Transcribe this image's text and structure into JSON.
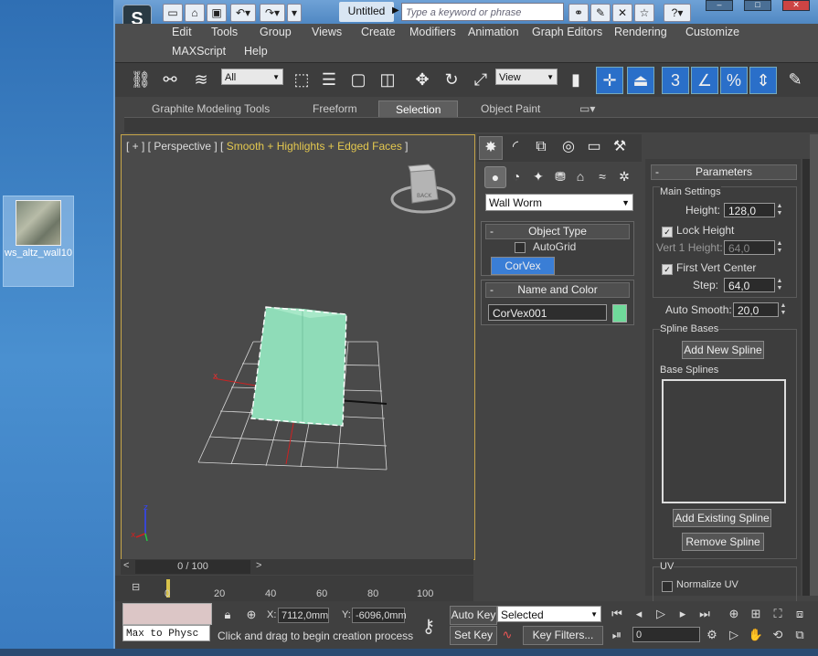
{
  "desktop": {
    "icon_label": "ws_altz_wall10"
  },
  "titlebar": {
    "document_title": "Untitled",
    "search_placeholder": "Type a keyword or phrase",
    "logo_glyph": "S"
  },
  "menu": {
    "row1": [
      "Edit",
      "Tools",
      "Group",
      "Views",
      "Create",
      "Modifiers",
      "Animation",
      "Graph Editors",
      "Rendering",
      "Customize"
    ],
    "row2": [
      "MAXScript",
      "Help"
    ]
  },
  "toolbar": {
    "selection_filter": "All",
    "ref_coord": "View",
    "snap_label": "3"
  },
  "ribbon": {
    "tabs": [
      "Graphite Modeling Tools",
      "Freeform",
      "Selection",
      "Object Paint"
    ],
    "active_tab": "Selection"
  },
  "viewport": {
    "label_prefix": "[ + ] [ Perspective ] [ ",
    "label_shading": "Smooth + Highlights + Edged Faces",
    "label_suffix": " ]",
    "box_color": "#8fdcb8",
    "selection_color": "#ffffff"
  },
  "timeslider": {
    "frame_readout": "0 / 100"
  },
  "trackbar": {
    "ticks": [
      "0",
      "20",
      "40",
      "60",
      "80",
      "100"
    ]
  },
  "command_panel": {
    "category": "Wall Worm",
    "object_type": {
      "title": "Object Type",
      "autogrid_label": "AutoGrid",
      "button_label": "CorVex"
    },
    "name_color": {
      "title": "Name and Color",
      "object_name": "CorVex001",
      "swatch_color": "#6fd99a"
    }
  },
  "parameters": {
    "title": "Parameters",
    "main_settings_title": "Main Settings",
    "height_label": "Height:",
    "height_value": "128,0",
    "lock_height_label": "Lock Height",
    "lock_height_checked": true,
    "vert1_label": "Vert 1 Height:",
    "vert1_value": "64,0",
    "first_vert_label": "First Vert Center",
    "first_vert_checked": true,
    "step_label": "Step:",
    "step_value": "64,0",
    "auto_smooth_label": "Auto Smooth:",
    "auto_smooth_value": "20,0",
    "spline_bases_title": "Spline Bases",
    "add_new_spline": "Add New Spline",
    "base_splines_label": "Base Splines",
    "add_existing_spline": "Add Existing Spline",
    "remove_spline": "Remove Spline",
    "uv_title": "UV",
    "normalize_uv_label": "Normalize UV"
  },
  "statusbar": {
    "maxscript_text": "Max to Physc",
    "x_label": "X:",
    "x_value": "7112,0mm",
    "y_label": "Y:",
    "y_value": "-6096,0mm",
    "prompt": "Click and drag to begin creation process",
    "auto_key": "Auto Key",
    "set_key": "Set Key",
    "key_mode": "Selected",
    "key_filters": "Key Filters...",
    "frame_value": "0"
  }
}
